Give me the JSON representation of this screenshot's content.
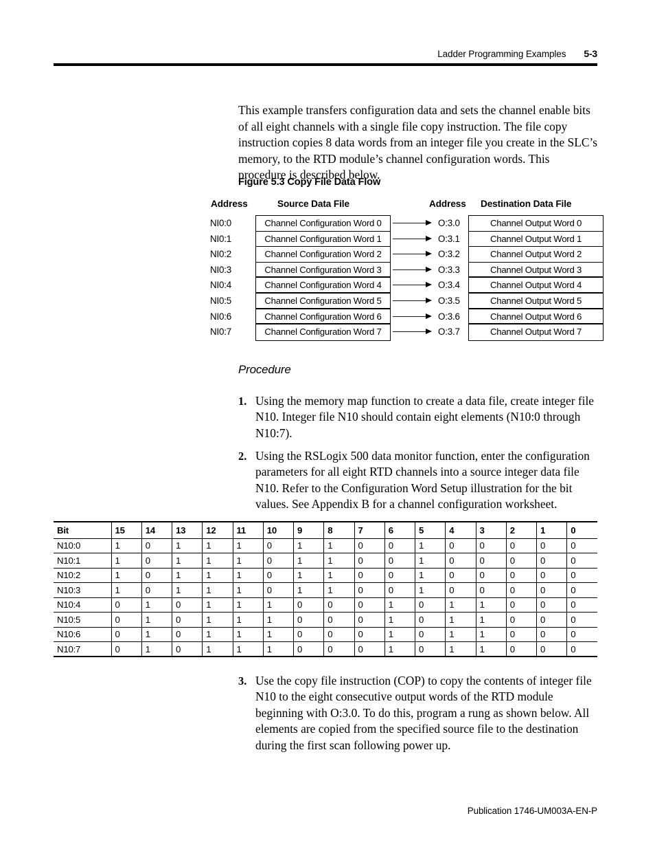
{
  "header": {
    "title": "Ladder Programming Examples",
    "page_number": "5-3"
  },
  "intro_paragraph": "This example transfers configuration data and sets the channel enable bits of all eight channels with a single file copy instruction. The file copy instruction copies 8 data words from an integer file you create in the SLC’s memory, to the RTD module’s channel configuration words. This procedure is described below.",
  "figure": {
    "caption": "Figure 5.3 Copy File Data Flow",
    "source_address_header": "Address",
    "source_file_header": "Source Data File",
    "destination_address_header": "Address",
    "destination_file_header": "Destination Data File",
    "source_addresses": [
      "NI0:0",
      "NI0:1",
      "NI0:2",
      "NI0:3",
      "NI0:4",
      "NI0:5",
      "NI0:6",
      "NI0:7"
    ],
    "source_words": [
      "Channel Configuration Word 0",
      "Channel Configuration Word 1",
      "Channel Configuration Word 2",
      "Channel Configuration Word 3",
      "Channel Configuration Word 4",
      "Channel Configuration Word 5",
      "Channel Configuration Word 6",
      "Channel Configuration Word 7"
    ],
    "destination_addresses": [
      "O:3.0",
      "O:3.1",
      "O:3.2",
      "O:3.3",
      "O:3.4",
      "O:3.5",
      "O:3.6",
      "O:3.7"
    ],
    "destination_words": [
      "Channel Output Word 0",
      "Channel Output Word 1",
      "Channel Output Word 2",
      "Channel Output Word 3",
      "Channel Output Word 4",
      "Channel Output Word 5",
      "Channel Output Word 6",
      "Channel Output Word 7"
    ]
  },
  "procedure": {
    "heading": "Procedure",
    "items": [
      {
        "number": "1.",
        "text": "Using the memory map function to create a data file, create integer file N10. Integer file N10 should contain eight elements (N10:0 through N10:7)."
      },
      {
        "number": "2.",
        "text": "Using the RSLogix 500 data monitor function, enter the configuration parameters for all eight RTD channels into a source integer data file N10. Refer to the Configuration Word Setup illustration for the bit values. See Appendix B for a channel configuration worksheet."
      },
      {
        "number": "3.",
        "text": "Use the copy file instruction (COP) to copy the contents of integer file N10 to the eight consecutive output words of the RTD module beginning with O:3.0. To do this, program a rung as shown below. All elements are copied from the specified source file to the destination during the first scan following power up."
      }
    ]
  },
  "bit_table": {
    "columns": [
      "Bit",
      "15",
      "14",
      "13",
      "12",
      "11",
      "10",
      "9",
      "8",
      "7",
      "6",
      "5",
      "4",
      "3",
      "2",
      "1",
      "0"
    ],
    "rows": [
      {
        "label": "N10:0",
        "bits": [
          "1",
          "0",
          "1",
          "1",
          "1",
          "0",
          "1",
          "1",
          "0",
          "0",
          "1",
          "0",
          "0",
          "0",
          "0",
          "0"
        ]
      },
      {
        "label": "N10:1",
        "bits": [
          "1",
          "0",
          "1",
          "1",
          "1",
          "0",
          "1",
          "1",
          "0",
          "0",
          "1",
          "0",
          "0",
          "0",
          "0",
          "0"
        ]
      },
      {
        "label": "N10:2",
        "bits": [
          "1",
          "0",
          "1",
          "1",
          "1",
          "0",
          "1",
          "1",
          "0",
          "0",
          "1",
          "0",
          "0",
          "0",
          "0",
          "0"
        ]
      },
      {
        "label": "N10:3",
        "bits": [
          "1",
          "0",
          "1",
          "1",
          "1",
          "0",
          "1",
          "1",
          "0",
          "0",
          "1",
          "0",
          "0",
          "0",
          "0",
          "0"
        ]
      },
      {
        "label": "N10:4",
        "bits": [
          "0",
          "1",
          "0",
          "1",
          "1",
          "1",
          "0",
          "0",
          "0",
          "1",
          "0",
          "1",
          "1",
          "0",
          "0",
          "0"
        ]
      },
      {
        "label": "N10:5",
        "bits": [
          "0",
          "1",
          "0",
          "1",
          "1",
          "1",
          "0",
          "0",
          "0",
          "1",
          "0",
          "1",
          "1",
          "0",
          "0",
          "0"
        ]
      },
      {
        "label": "N10:6",
        "bits": [
          "0",
          "1",
          "0",
          "1",
          "1",
          "1",
          "0",
          "0",
          "0",
          "1",
          "0",
          "1",
          "1",
          "0",
          "0",
          "0"
        ]
      },
      {
        "label": "N10:7",
        "bits": [
          "0",
          "1",
          "0",
          "1",
          "1",
          "1",
          "0",
          "0",
          "0",
          "1",
          "0",
          "1",
          "1",
          "0",
          "0",
          "0"
        ]
      }
    ]
  },
  "footer": {
    "publication": "Publication 1746-UM003A-EN-P"
  }
}
